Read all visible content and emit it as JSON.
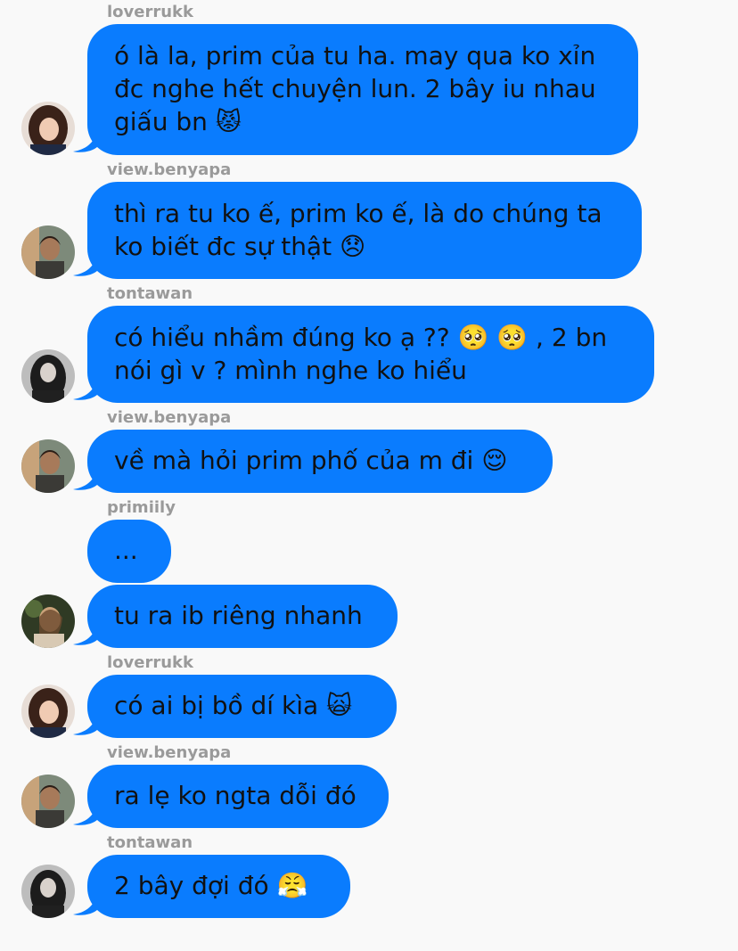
{
  "messages": [
    {
      "sender": "loverrukk",
      "text": "ó là la, prim của tu ha. may qua ko xỉn\nđc nghe hết chuyện lun. 2 bây iu nhau\ngiấu bn",
      "emoji": "😾",
      "emoji_name": "pouting-cat-emoji",
      "avatar": "loverrukk"
    },
    {
      "sender": "view.benyapa",
      "text": "thì ra tu ko ế, prim ko ế, là do chúng ta\nko biết đc sự thật",
      "emoji": "😞",
      "emoji_name": "disappointed-face-emoji",
      "avatar": "benyapa"
    },
    {
      "sender": "tontawan",
      "text": "có hiểu nhầm đúng ko ạ ?? 🥺 🥺 , 2 bn\nnói gì v ? mình nghe ko hiểu",
      "emoji": "",
      "emoji_name": "",
      "avatar": "tontawan"
    },
    {
      "sender": "view.benyapa",
      "text": "về mà hỏi prim phố của m đi",
      "emoji": "😌",
      "emoji_name": "relieved-face-emoji",
      "avatar": "benyapa"
    },
    {
      "sender": "primiily",
      "text": "...",
      "emoji": "",
      "emoji_name": "",
      "avatar": ""
    },
    {
      "sender": "",
      "text": "tu ra ib riêng nhanh",
      "emoji": "",
      "emoji_name": "",
      "avatar": "primiily"
    },
    {
      "sender": "loverrukk",
      "text": "có ai bị bồ dí kìa",
      "emoji": "🙀",
      "emoji_name": "weary-cat-emoji",
      "avatar": "loverrukk"
    },
    {
      "sender": "view.benyapa",
      "text": "ra lẹ ko ngta dỗi đó",
      "emoji": "",
      "emoji_name": "",
      "avatar": "benyapa"
    },
    {
      "sender": "tontawan",
      "text": "2 bây đợi đó",
      "emoji": "😤",
      "emoji_name": "huffing-face-emoji",
      "avatar": "tontawan"
    }
  ],
  "colors": {
    "bubble": "#0a7cfe",
    "background": "#f9f9f9",
    "sender_text": "#9a9a9a",
    "message_text": "#111111"
  }
}
